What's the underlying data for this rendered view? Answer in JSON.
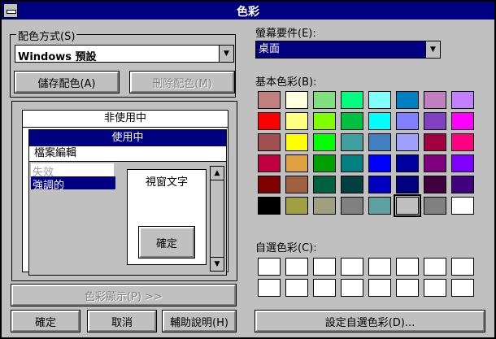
{
  "window": {
    "title": "色彩"
  },
  "scheme": {
    "label": "配色方式(S)",
    "value": "Windows 預設",
    "save_button": "儲存配色(A)",
    "delete_button": "刪除配色(M)"
  },
  "preview": {
    "inactive_title": "非使用中",
    "active_title": "使用中",
    "menu_normal": "檔案編輯",
    "menu_disabled": "失效",
    "menu_highlight": "強調的",
    "window_text": "視窗文字",
    "ok_label": "確定"
  },
  "palette_button": "色彩顯示(P) >>",
  "buttons": {
    "ok": "確定",
    "cancel": "取消",
    "help": "輔助說明(H)"
  },
  "element": {
    "label": "螢幕要件(E):",
    "value": "桌面"
  },
  "basic_colors": {
    "label": "基本色彩(B):",
    "colors": [
      [
        "#c08080",
        "#ffffe0",
        "#80e080",
        "#00ff80",
        "#80ffff",
        "#0080c0",
        "#c080c0",
        "#c080ff"
      ],
      [
        "#ff0000",
        "#ffff80",
        "#80ff00",
        "#00c040",
        "#00ffff",
        "#8080ff",
        "#8040c0",
        "#ff00ff"
      ],
      [
        "#a05050",
        "#ffff00",
        "#00ff00",
        "#40a0a0",
        "#4080c0",
        "#a0a0ff",
        "#a00040",
        "#ff0080"
      ],
      [
        "#c00040",
        "#e0a040",
        "#00a000",
        "#008080",
        "#0000ff",
        "#0000a0",
        "#800080",
        "#8000ff"
      ],
      [
        "#800000",
        "#a06040",
        "#006040",
        "#004040",
        "#0000c0",
        "#000080",
        "#400040",
        "#400080"
      ],
      [
        "#000000",
        "#a0a040",
        "#a0a080",
        "#808080",
        "#60a0a0",
        "#c0c0c0",
        "#808080",
        "#ffffff"
      ]
    ]
  },
  "custom_colors": {
    "label": "自選色彩(C):",
    "rows": 2,
    "cols": 8
  },
  "define_button": "設定自選色彩(D)..."
}
